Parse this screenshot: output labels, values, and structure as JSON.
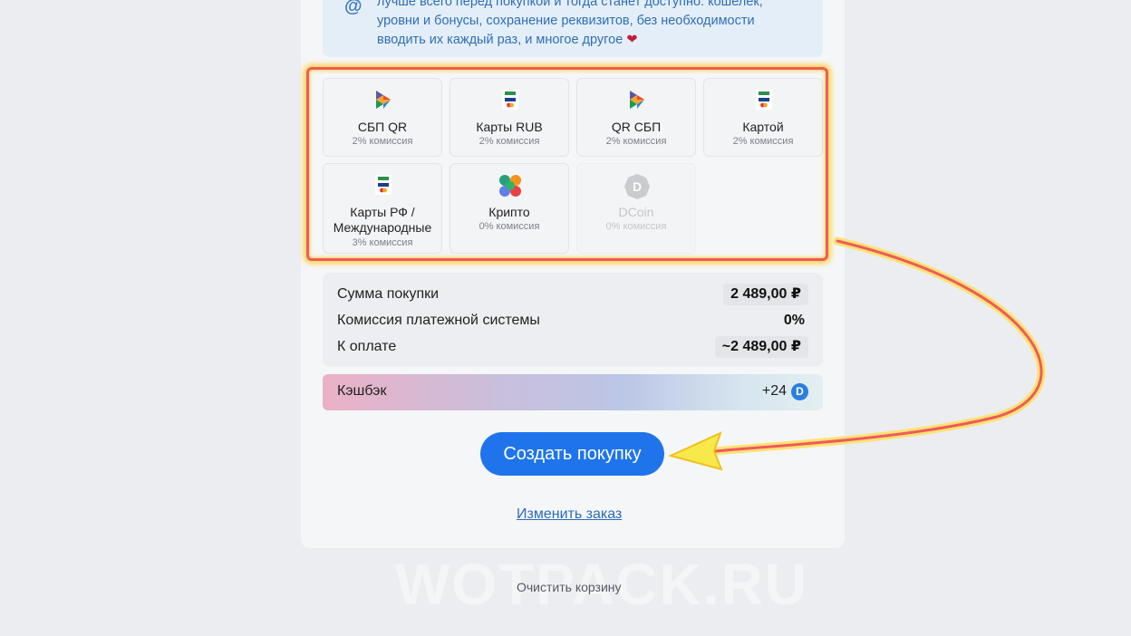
{
  "info": {
    "icon": "at-icon",
    "lines": [
      "лучше всего перед покупкой и тогда станет доступно: кошелек,",
      "уровни и бонусы, сохранение реквизитов, без необходимости",
      "вводить их каждый раз, и многое другое"
    ],
    "heart": "❤"
  },
  "methods": [
    {
      "name": "СБП QR",
      "fee": "2% комиссия",
      "icon": "sbp-icon"
    },
    {
      "name": "Карты RUB",
      "fee": "2% комиссия",
      "icon": "mir-visa-card-icon"
    },
    {
      "name": "QR СБП",
      "fee": "2% комиссия",
      "icon": "sbp-icon"
    },
    {
      "name": "Картой",
      "fee": "2% комиссия",
      "icon": "mir-visa-card-icon"
    },
    {
      "name": "Карты РФ / Международные",
      "fee": "3% комиссия",
      "icon": "mir-visa-card-icon"
    },
    {
      "name": "Крипто",
      "fee": "0% комиссия",
      "icon": "crypto-icon"
    },
    {
      "name": "DCoin",
      "fee": "0% комиссия",
      "icon": "dcoin-icon",
      "disabled": true
    }
  ],
  "summary": {
    "purchase_label": "Сумма покупки",
    "purchase_value": "2 489,00 ₽",
    "fee_label": "Комиссия платежной системы",
    "fee_value": "0%",
    "total_label": "К оплате",
    "total_value": "~2 489,00 ₽"
  },
  "cashback": {
    "label": "Кэшбэк",
    "value": "+24"
  },
  "create_button": "Создать покупку",
  "change_order_link": "Изменить заказ",
  "clear_cart": "Очистить корзину",
  "watermark": "WOTPACK.RU",
  "colors": {
    "accent": "#1f74ec",
    "highlight_border": "#f05a5a",
    "highlight_glow": "#ffd34a"
  }
}
